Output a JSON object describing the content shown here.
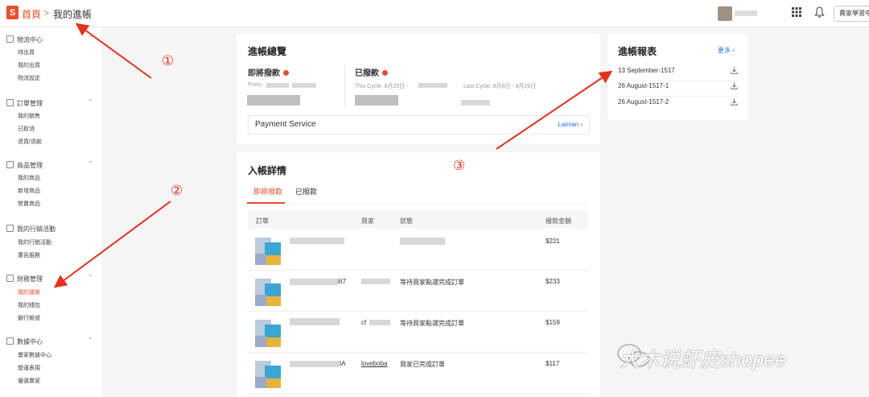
{
  "breadcrumb": {
    "home": "首頁",
    "separator": ">",
    "current": "我的進帳"
  },
  "topbar": {
    "button_label": "賣家學習中心"
  },
  "sidebar": {
    "sections": [
      {
        "title": "物流中心",
        "items": [
          "待出貨",
          "我的出貨",
          "物流設定"
        ]
      },
      {
        "title": "訂單管理",
        "items": [
          "我的銷售",
          "已取消",
          "退貨/退款"
        ]
      },
      {
        "title": "商品管理",
        "items": [
          "我的商品",
          "新增商品",
          "禁賣商品"
        ]
      },
      {
        "title": "我的行銷活動",
        "items": [
          "我的行銷活動",
          "廣告服務"
        ]
      },
      {
        "title": "財務管理",
        "items": [
          "我的進帳",
          "我的錢包",
          "銀行帳號"
        ]
      },
      {
        "title": "數據中心",
        "items": [
          "賣家數據中心",
          "營運表現",
          "優選賣家"
        ]
      }
    ],
    "active_item": "我的進帳"
  },
  "overview": {
    "title": "進帳總覽",
    "pending_label": "即將撥款",
    "released_label": "已撥款",
    "from_label": "From: ",
    "this_cycle": "This Cycle: 8月25日 - ",
    "last_cycle": "Last Cycle: 8月8日 - 8月26日",
    "payment_service": "Payment Service",
    "payment_link": "Lainian"
  },
  "details": {
    "title": "入帳詳情",
    "tabs": [
      "即將撥款",
      "已撥款"
    ],
    "columns": [
      "訂單",
      "買家",
      "狀態",
      "撥款金額"
    ],
    "rows": [
      {
        "order_suffix": "",
        "buyer": "",
        "status": "",
        "amount": "$221"
      },
      {
        "order_suffix": "lit7",
        "buyer": "",
        "status": "等待買家點選完成訂單",
        "amount": "$233"
      },
      {
        "order_suffix": "",
        "buyer": "cf",
        "status": "等待買家點選完成訂單",
        "amount": "$159"
      },
      {
        "order_suffix": "IA",
        "buyer": "loveboba",
        "status": "買家已完成訂單",
        "amount": "$117"
      }
    ]
  },
  "reports": {
    "title": "進帳報表",
    "more": "更多",
    "items": [
      "13 September-1517",
      "26 August-1517-1",
      "26 August-1517-2"
    ]
  },
  "annotations": {
    "circle1": "①",
    "circle2": "②",
    "circle3": "③",
    "arrow_color": "#e8301e"
  },
  "watermark": {
    "text": "大木说虾皮shopee"
  },
  "colors": {
    "brand": "#ee4d2d",
    "link": "#1a73e8"
  }
}
